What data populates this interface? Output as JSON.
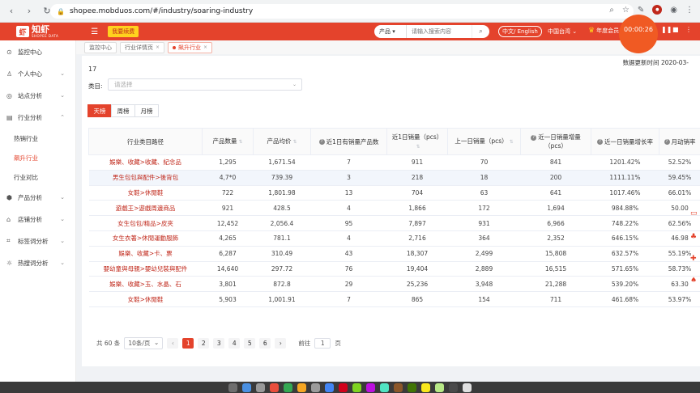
{
  "browser": {
    "url": "shopee.mobduos.com/#/industry/soaring-industry"
  },
  "header": {
    "logo_text": "知虾",
    "logo_sub": "SHOPEE DATA",
    "renew_label": "我要续费",
    "search_category": "产品",
    "search_placeholder": "请输入搜索内容",
    "lang_label": "中文/ English",
    "region_label": "中国台湾",
    "vip_label": "年度会员",
    "timer": "00:00:26"
  },
  "sidebar": {
    "items": [
      {
        "label": "监控中心",
        "icon": "monitor-icon"
      },
      {
        "label": "个人中心",
        "icon": "user-icon"
      },
      {
        "label": "站点分析",
        "icon": "location-icon"
      },
      {
        "label": "行业分析",
        "icon": "industry-icon"
      },
      {
        "label": "产品分析",
        "icon": "product-icon"
      },
      {
        "label": "店铺分析",
        "icon": "shop-icon"
      },
      {
        "label": "标签词分析",
        "icon": "tag-icon"
      },
      {
        "label": "热搜词分析",
        "icon": "hot-icon"
      }
    ],
    "sub_items": [
      {
        "label": "热销行业"
      },
      {
        "label": "飙升行业"
      },
      {
        "label": "行业对比"
      }
    ]
  },
  "page_tabs": [
    {
      "label": "监控中心"
    },
    {
      "label": "行业详情页"
    },
    {
      "label": "飙升行业"
    }
  ],
  "filters": {
    "page_no": "17",
    "update_time": "数据更新时间 2020-03-",
    "category_label": "类目:",
    "category_placeholder": "请选择",
    "range_tabs": [
      "天榜",
      "周榜",
      "月榜"
    ]
  },
  "table": {
    "headers": [
      "行业类目路径",
      "产品数量",
      "产品均价",
      "近1日有销量产品数",
      "近1日销量（pcs）",
      "上一日销量（pcs）",
      "近一日销量增量（pcs）",
      "近一日销量增长率",
      "月动销率"
    ],
    "rows": [
      [
        "娛樂、收藏>收藏、紀念品",
        "1,295",
        "1,671.54",
        "7",
        "911",
        "70",
        "841",
        "1201.42%",
        "52.52%"
      ],
      [
        "男生包包與配件>後背包",
        "4,7*0",
        "739.39",
        "3",
        "218",
        "18",
        "200",
        "1111.11%",
        "59.45%"
      ],
      [
        "女鞋>休閒鞋",
        "722",
        "1,801.98",
        "13",
        "704",
        "63",
        "641",
        "1017.46%",
        "66.01%"
      ],
      [
        "遊戲王>遊戲周邊商品",
        "921",
        "428.5",
        "4",
        "1,866",
        "172",
        "1,694",
        "984.88%",
        "50.00"
      ],
      [
        "女生包包/精品>皮夾",
        "12,452",
        "2,056.4",
        "95",
        "7,897",
        "931",
        "6,966",
        "748.22%",
        "62.56%"
      ],
      [
        "女生衣著>休閒運動服飾",
        "4,265",
        "781.1",
        "4",
        "2,716",
        "364",
        "2,352",
        "646.15%",
        "46.98"
      ],
      [
        "娛樂、收藏>卡、票",
        "6,287",
        "310.49",
        "43",
        "18,307",
        "2,499",
        "15,808",
        "632.57%",
        "55.19%"
      ],
      [
        "嬰幼童與母親>嬰幼兒裝與配件",
        "14,640",
        "297.72",
        "76",
        "19,404",
        "2,889",
        "16,515",
        "571.65%",
        "58.73%"
      ],
      [
        "娛樂、收藏>玉、水晶、石",
        "3,801",
        "872.8",
        "29",
        "25,236",
        "3,948",
        "21,288",
        "539.20%",
        "63.30"
      ],
      [
        "女鞋>休閒鞋",
        "5,903",
        "1,001.91",
        "7",
        "865",
        "154",
        "711",
        "461.68%",
        "53.97%"
      ]
    ]
  },
  "pagination": {
    "total": "共 60 条",
    "page_size": "10条/页",
    "pages": [
      "1",
      "2",
      "3",
      "4",
      "5",
      "6"
    ],
    "goto_label": "前往",
    "goto_value": "1",
    "goto_suffix": "页"
  }
}
